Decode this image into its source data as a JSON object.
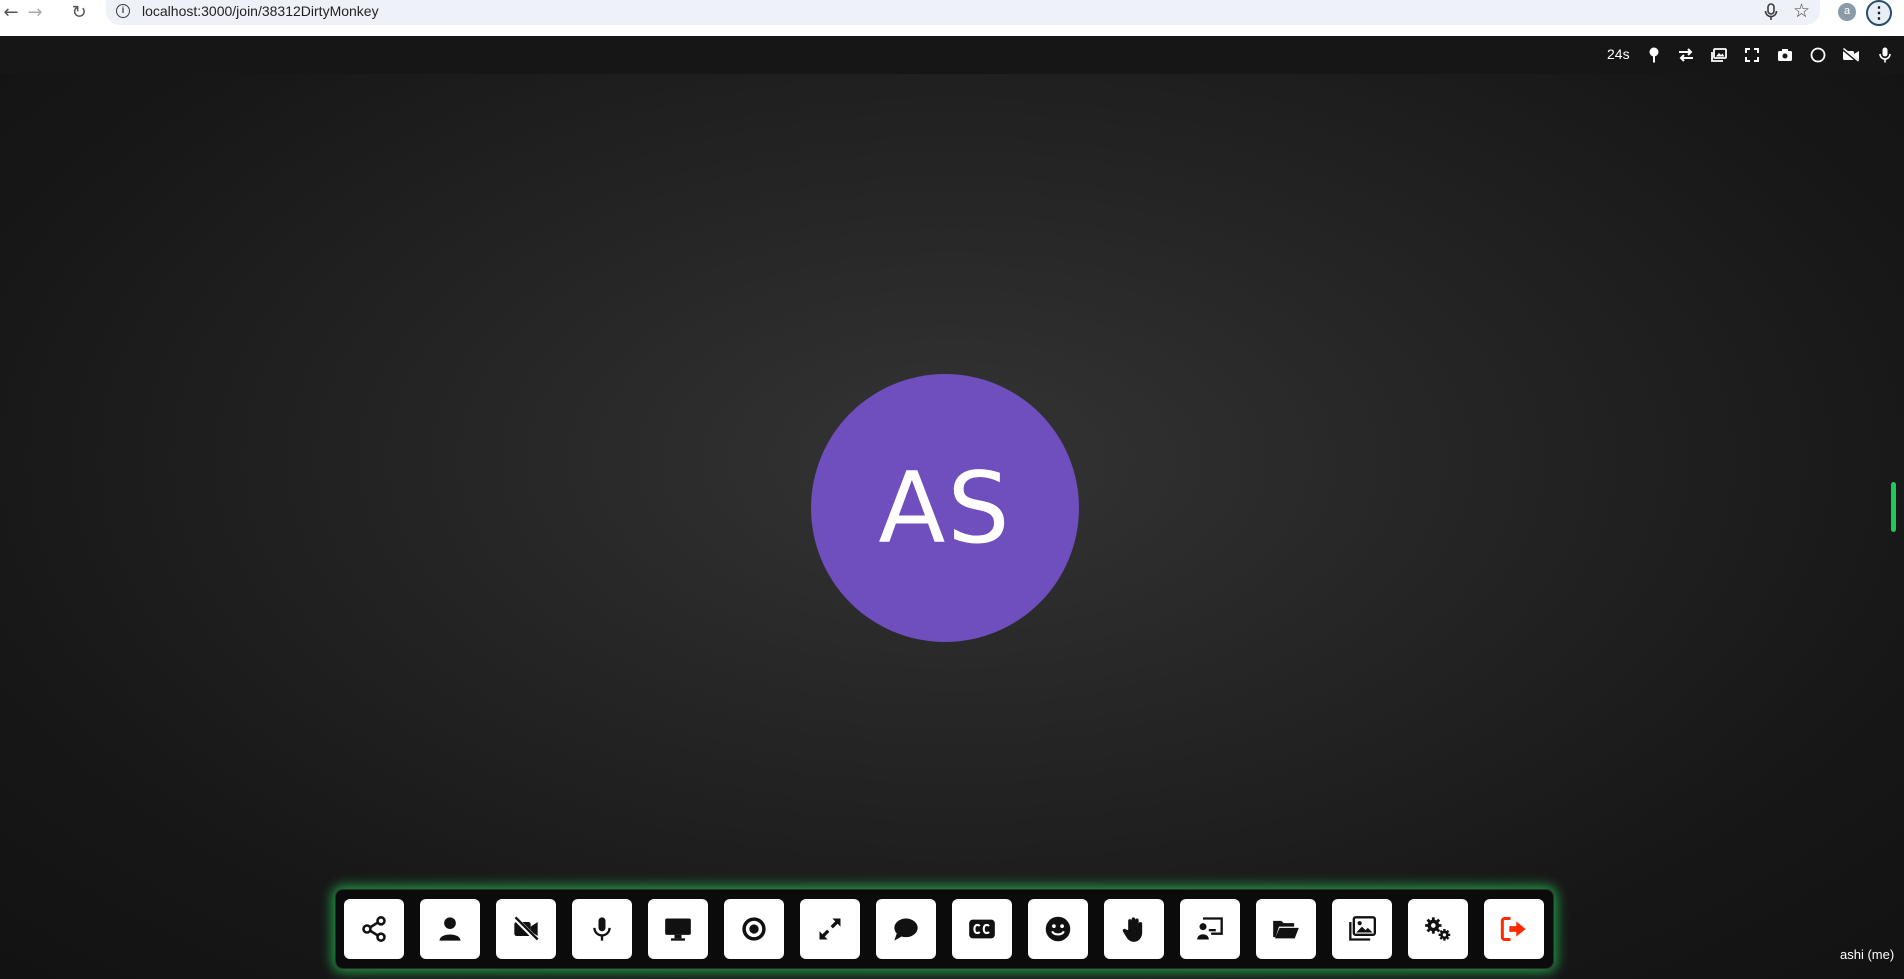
{
  "browser": {
    "url": "localhost:3000/join/38312DirtyMonkey",
    "back_glyph": "←",
    "forward_glyph": "→",
    "reload_glyph": "↻",
    "info_glyph": "i",
    "star_glyph": "☆",
    "profile_initial": "a",
    "menu_glyph": "⋮"
  },
  "top_bar": {
    "timer": "24s",
    "icons": [
      "pin-icon",
      "swap-icon",
      "picture-in-picture-icon",
      "fullscreen-icon",
      "snapshot-icon",
      "record-status-icon",
      "camera-off-icon",
      "mic-icon"
    ]
  },
  "participant": {
    "initials": "AS",
    "name": "ashi (me)",
    "avatar_color": "#6f4ebd",
    "audio_level": 0.5
  },
  "bottom_bar": {
    "buttons": [
      "share",
      "participants",
      "video-off",
      "mic",
      "screen-share",
      "record",
      "fullscreen",
      "chat",
      "captions",
      "emoji",
      "raise-hand",
      "whiteboard",
      "file-share",
      "virtual-background",
      "settings",
      "leave"
    ],
    "accent_glow": "#28c85a",
    "leave_color": "#ff2a00"
  }
}
